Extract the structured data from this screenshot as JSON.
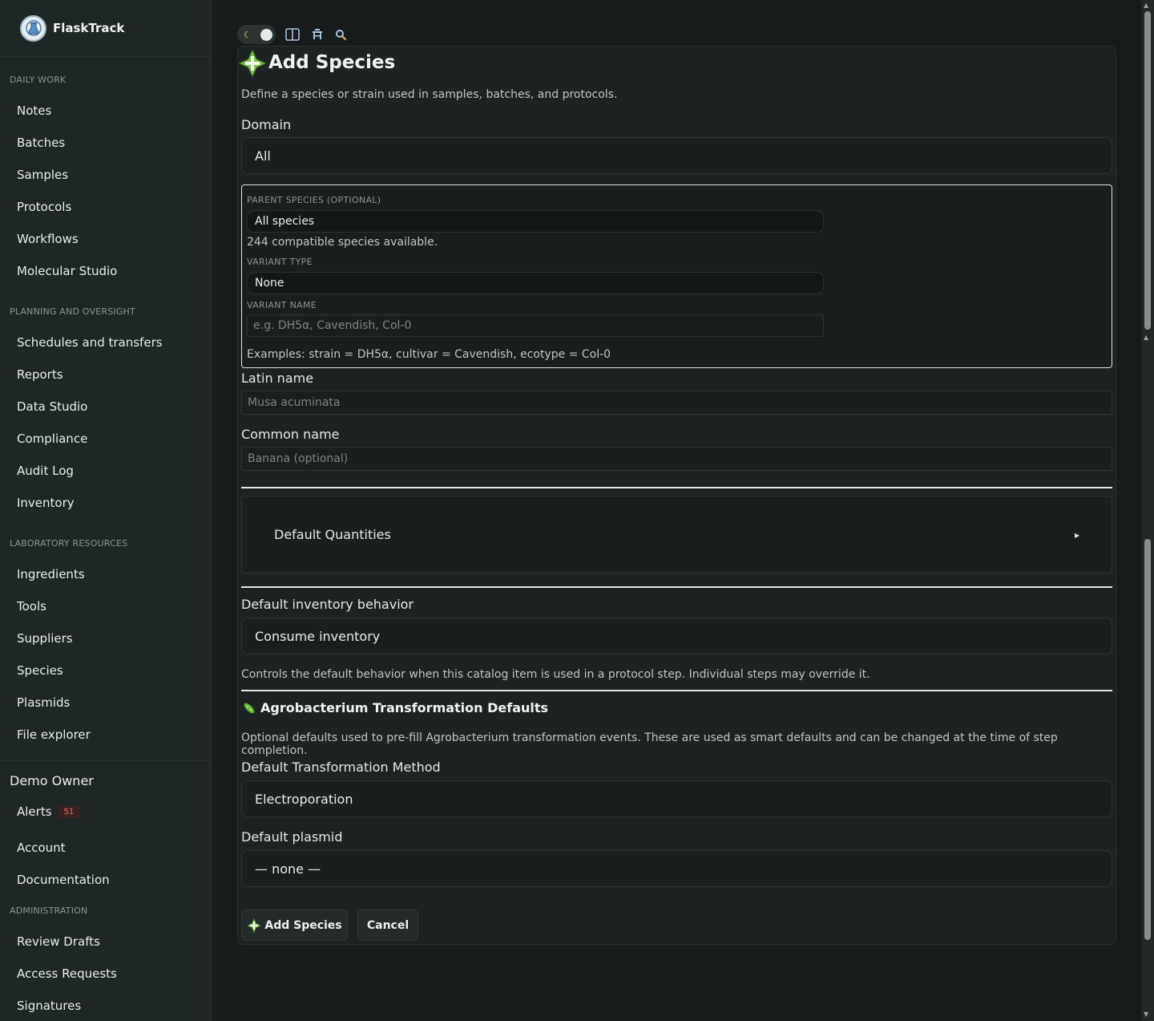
{
  "app": {
    "name": "FlaskTrack"
  },
  "sidebar": {
    "sections": [
      {
        "label": "DAILY WORK",
        "items": [
          "Notes",
          "Batches",
          "Samples",
          "Protocols",
          "Workflows",
          "Molecular Studio"
        ]
      },
      {
        "label": "PLANNING AND OVERSIGHT",
        "items": [
          "Schedules and transfers",
          "Reports",
          "Data Studio",
          "Compliance",
          "Audit Log",
          "Inventory"
        ]
      },
      {
        "label": "LABORATORY RESOURCES",
        "items": [
          "Ingredients",
          "Tools",
          "Suppliers",
          "Species",
          "Plasmids",
          "File explorer"
        ]
      }
    ],
    "user": {
      "name": "Demo Owner",
      "alerts_label": "Alerts",
      "alerts_count": "51",
      "account": "Account",
      "documentation": "Documentation"
    },
    "admin": {
      "label": "ADMINISTRATION",
      "items": [
        "Review Drafts",
        "Access Requests",
        "Signatures"
      ]
    }
  },
  "toolbar": {
    "icons": [
      "moon-icon",
      "columns-icon",
      "bench-icon",
      "search-icon"
    ]
  },
  "form": {
    "title": "Add Species",
    "description": "Define a species or strain used in samples, batches, and protocols.",
    "domain": {
      "label": "Domain",
      "value": "All"
    },
    "parent_species": {
      "label": "PARENT SPECIES (OPTIONAL)",
      "value": "All species",
      "hint": "244 compatible species available."
    },
    "variant_type": {
      "label": "VARIANT TYPE",
      "value": "None"
    },
    "variant_name": {
      "label": "VARIANT NAME",
      "placeholder": "e.g. DH5α, Cavendish, Col-0"
    },
    "variant_examples": "Examples: strain = DH5α, cultivar = Cavendish, ecotype = Col-0",
    "latin_name": {
      "label": "Latin name",
      "placeholder": "Musa acuminata"
    },
    "common_name": {
      "label": "Common name",
      "placeholder": "Banana (optional)"
    },
    "default_quantities": {
      "label": "Default Quantities",
      "arrow": "▸"
    },
    "inventory_behavior": {
      "label": "Default inventory behavior",
      "value": "Consume inventory",
      "help": "Controls the default behavior when this catalog item is used in a protocol step. Individual steps may override it."
    },
    "agro": {
      "title": "Agrobacterium Transformation Defaults",
      "description": "Optional defaults used to pre-fill Agrobacterium transformation events. These are used as smart defaults and can be changed at the time of step completion.",
      "method": {
        "label": "Default Transformation Method",
        "value": "Electroporation"
      },
      "plasmid": {
        "label": "Default plasmid",
        "value": "— none —"
      }
    },
    "buttons": {
      "submit": "Add Species",
      "cancel": "Cancel"
    }
  },
  "colors": {
    "accent_green": "#7cc24a",
    "background": "#181b1b",
    "sidebar": "#1f2626"
  }
}
